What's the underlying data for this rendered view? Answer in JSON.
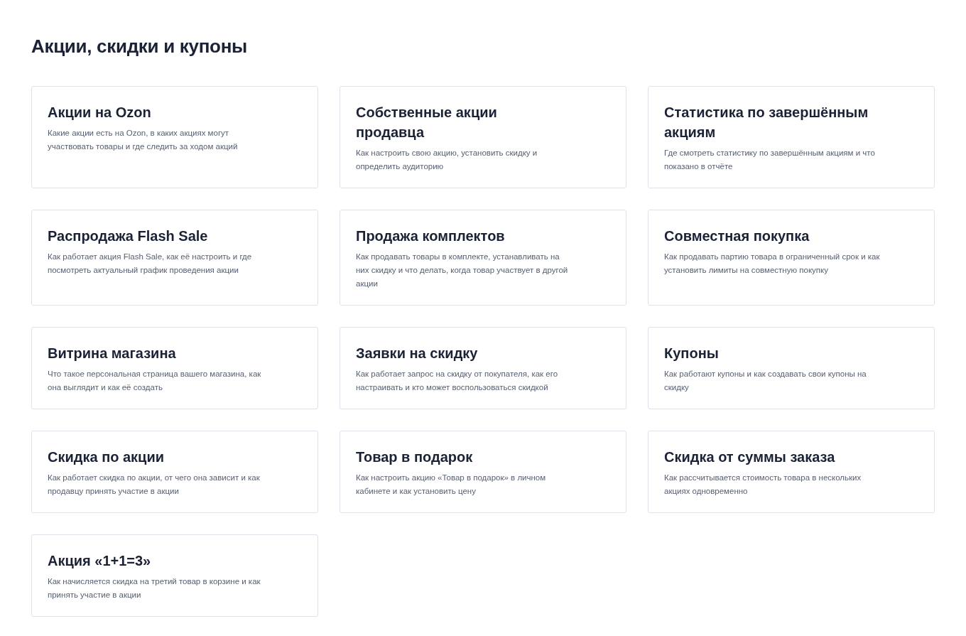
{
  "title": "Акции, скидки и купоны",
  "cards": [
    {
      "title": "Акции на Ozon",
      "description": "Какие акции есть на Ozon, в каких акциях могут участвовать товары и где следить за ходом акций"
    },
    {
      "title": "Собственные акции продавца",
      "description": "Как настроить свою акцию, установить скидку и определить аудиторию"
    },
    {
      "title": "Статистика по завершённым акциям",
      "description": "Где смотреть статистику по завершённым акциям и что показано в отчёте"
    },
    {
      "title": "Распродажа Flash Sale",
      "description": "Как работает акция Flash Sale, как её настроить и где посмотреть актуальный график проведения акции"
    },
    {
      "title": "Продажа комплектов",
      "description": "Как продавать товары в комплекте, устанавливать на них скидку и что делать, когда товар участвует в другой акции"
    },
    {
      "title": "Совместная покупка",
      "description": "Как продавать партию товара в ограниченный срок и как установить лимиты на совместную покупку"
    },
    {
      "title": "Витрина магазина",
      "description": "Что такое персональная страница вашего магазина, как она выглядит и как её создать"
    },
    {
      "title": "Заявки на скидку",
      "description": "Как работает запрос на скидку от покупателя, как его настраивать и кто может воспользоваться скидкой"
    },
    {
      "title": "Купоны",
      "description": "Как работают купоны и как создавать свои купоны на скидку"
    },
    {
      "title": "Скидка по акции",
      "description": "Как работает скидка по акции, от чего она зависит и как продавцу принять участие в акции"
    },
    {
      "title": "Товар в подарок",
      "description": "Как настроить акцию «Товар в подарок» в личном кабинете и как установить цену"
    },
    {
      "title": "Скидка от суммы заказа",
      "description": "Как рассчитывается стоимость товара в нескольких акциях одновременно"
    },
    {
      "title": "Акция «1+1=3»",
      "description": "Как начисляется скидка на третий товар в корзине и как принять участие в акции"
    }
  ]
}
